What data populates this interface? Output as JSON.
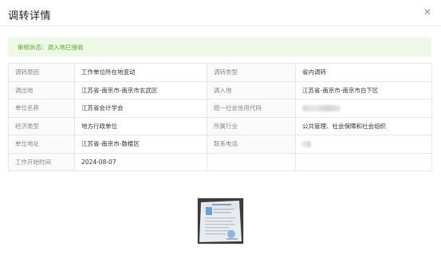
{
  "dialog": {
    "title": "调转详情",
    "close_icon": "close-icon"
  },
  "status": {
    "text": "审核状态：调入地已接收",
    "color": "#5aa62f",
    "background": "#eef8e6"
  },
  "details": [
    {
      "label_left": "调转原因",
      "value_left": "工作单位所在地变动",
      "label_right": "调转类型",
      "value_right": "省内调转"
    },
    {
      "label_left": "调出地",
      "value_left": "江苏省-南京市-南京市玄武区",
      "label_right": "调入地",
      "value_right": "江苏省-南京市-南京市白下区"
    },
    {
      "label_left": "单位名称",
      "value_left": "江苏省会计学会",
      "label_right": "统一社会信用代码",
      "value_right": ""
    },
    {
      "label_left": "经济类型",
      "value_left": "地方行政单位",
      "label_right": "所属行业",
      "value_right": "公共管理、社会保障和社会组织"
    },
    {
      "label_left": "单位地址",
      "value_left": "江苏省-南京市-鼓楼区",
      "label_right": "联系电话",
      "value_right": ""
    },
    {
      "label_left": "工作开始时间",
      "value_left": "2024-08-07",
      "label_right": "",
      "value_right": ""
    }
  ],
  "attachment": {
    "type": "document-photo-thumbnail"
  }
}
